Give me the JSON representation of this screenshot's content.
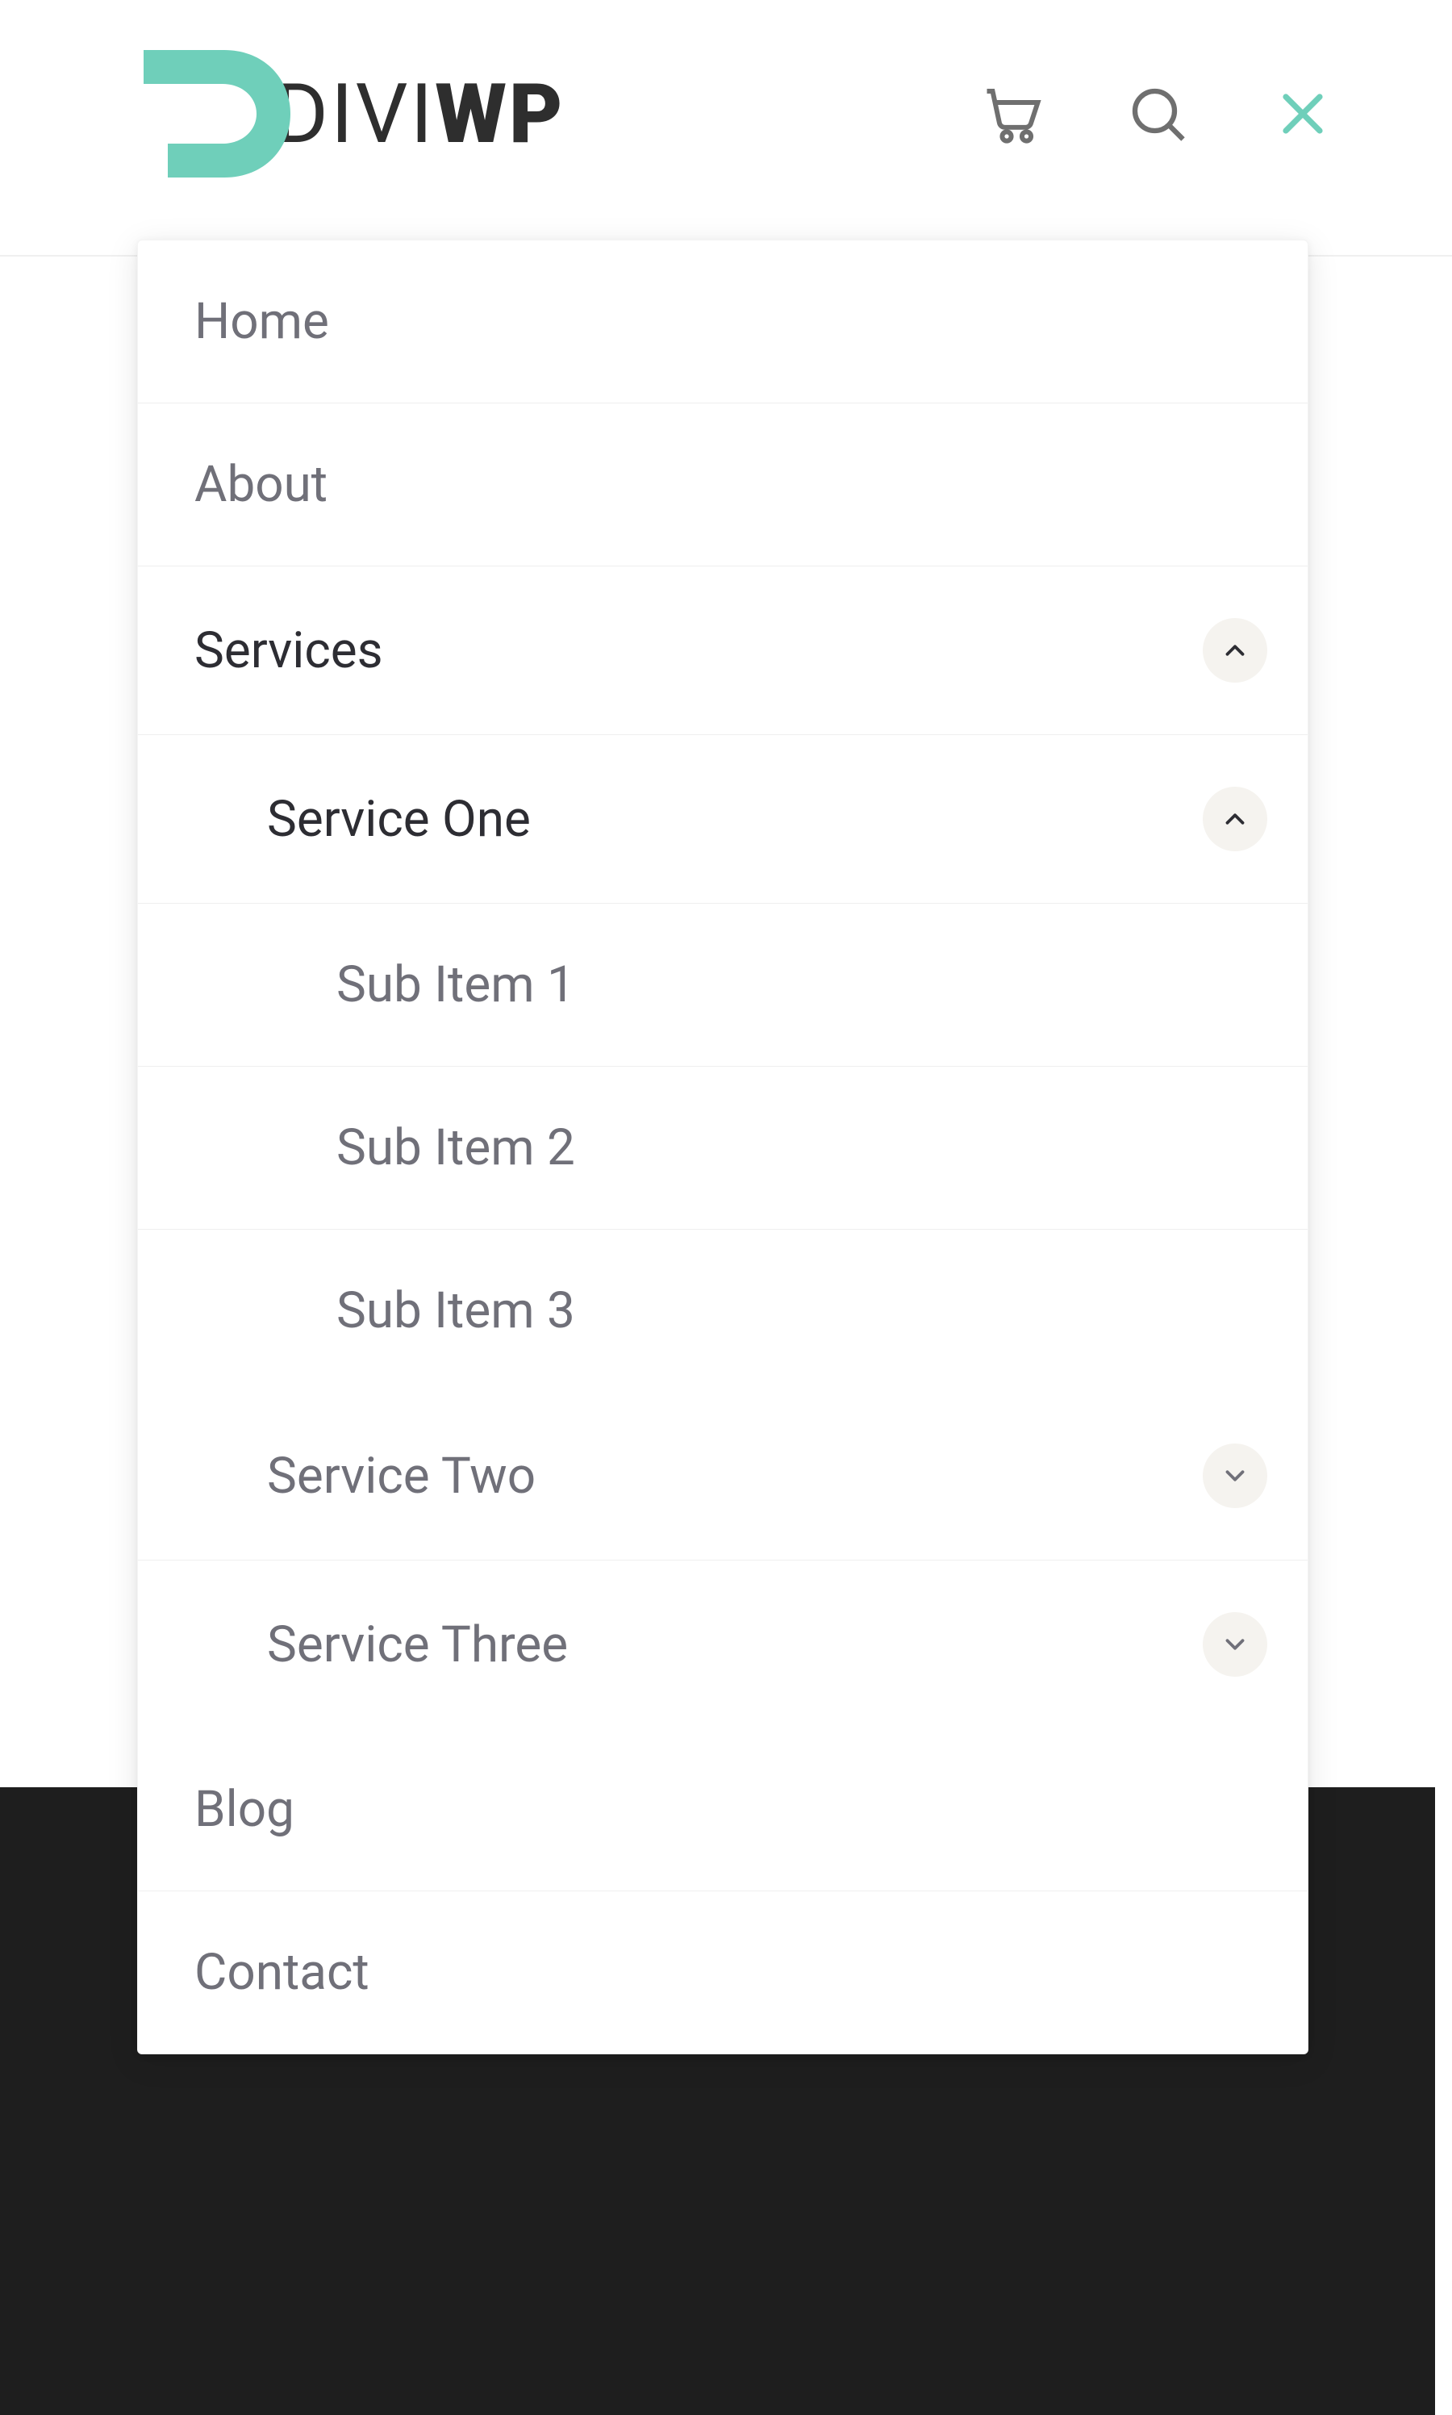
{
  "brand": {
    "text_thin": "DIVI",
    "text_bold": "WP",
    "accent": "#6fcfba",
    "dark": "#2e2e2e"
  },
  "menu": {
    "home": {
      "label": "Home"
    },
    "about": {
      "label": "About"
    },
    "services": {
      "label": "Services",
      "expanded": true,
      "children": {
        "service_one": {
          "label": "Service One",
          "expanded": true,
          "children": {
            "sub1": {
              "label": "Sub Item 1"
            },
            "sub2": {
              "label": "Sub Item 2"
            },
            "sub3": {
              "label": "Sub Item 3"
            }
          }
        },
        "service_two": {
          "label": "Service Two",
          "expanded": false
        },
        "service_three": {
          "label": "Service Three",
          "expanded": false
        }
      }
    },
    "blog": {
      "label": "Blog"
    },
    "contact": {
      "label": "Contact"
    }
  }
}
